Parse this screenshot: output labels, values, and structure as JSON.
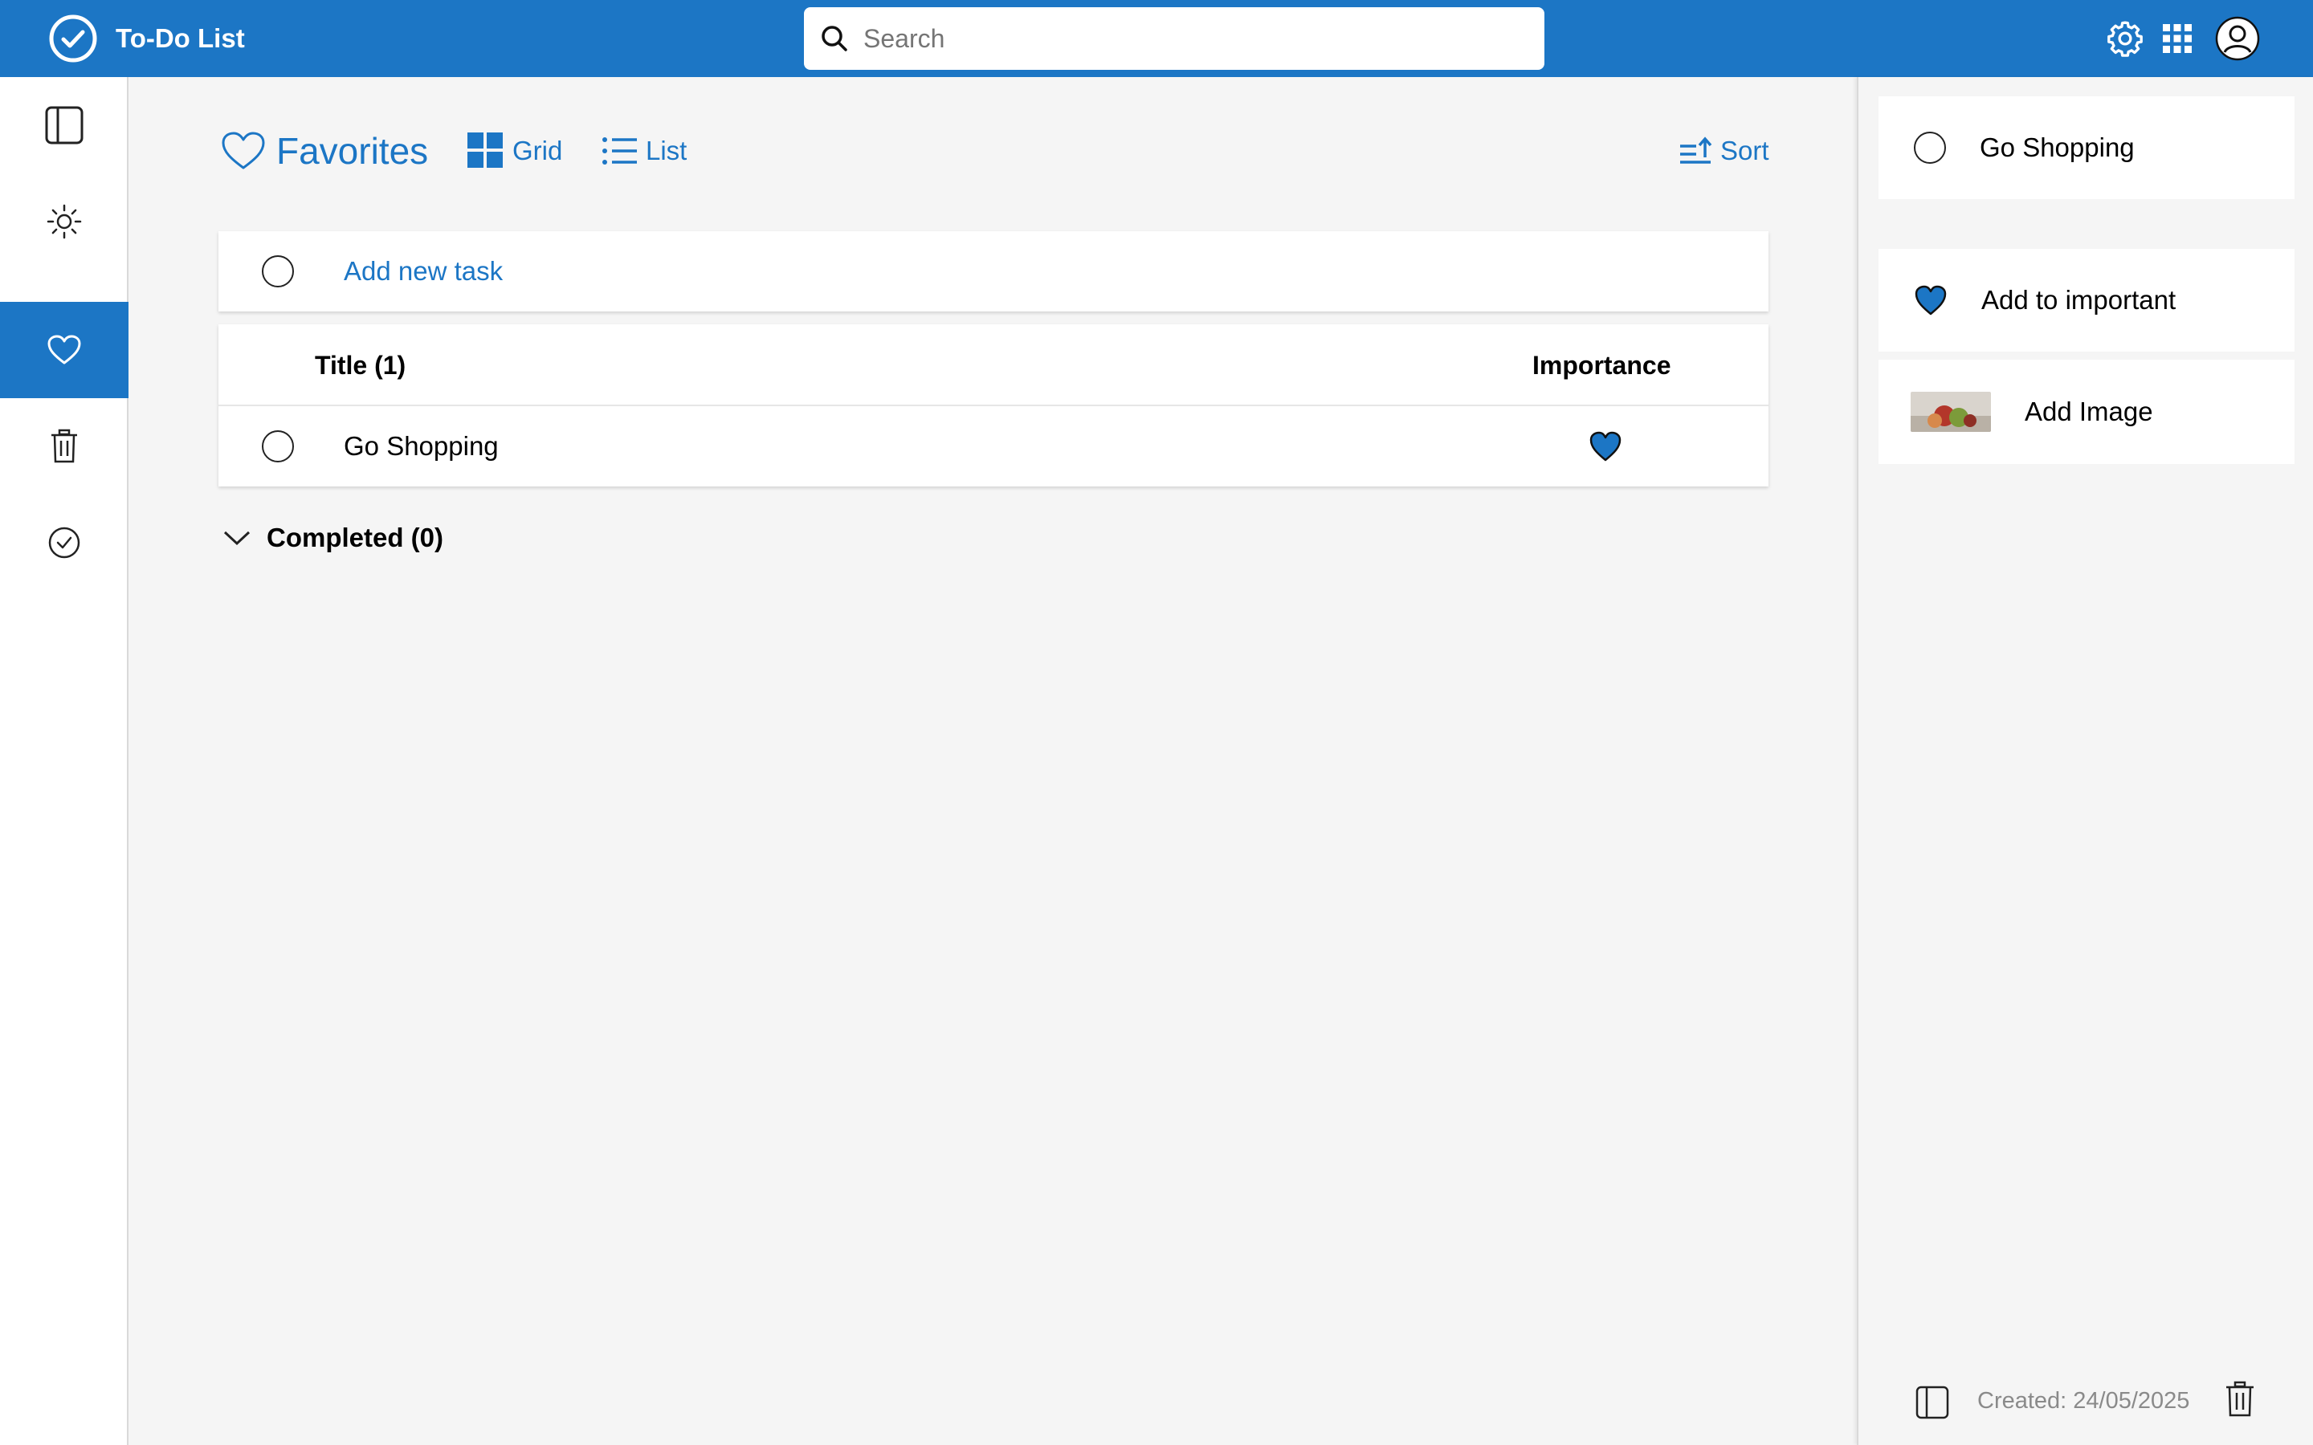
{
  "app": {
    "title": "To-Do List"
  },
  "search": {
    "placeholder": "Search"
  },
  "header_icons": [
    "settings-gear-icon",
    "apps-grid-icon",
    "user-avatar-icon"
  ],
  "nav": {
    "items": [
      {
        "name": "toggle-sidebar",
        "icon": "panel-icon"
      },
      {
        "name": "my-day",
        "icon": "sun-icon"
      },
      {
        "name": "favorites",
        "icon": "heart-icon",
        "active": true
      },
      {
        "name": "trash",
        "icon": "trash-icon"
      },
      {
        "name": "completed",
        "icon": "check-circle-icon"
      }
    ]
  },
  "main": {
    "title": "Favorites",
    "view_grid_label": "Grid",
    "view_list_label": "List",
    "sort_label": "Sort",
    "add_task_label": "Add new task",
    "table": {
      "title_header": "Title (1)",
      "importance_header": "Importance",
      "rows": [
        {
          "title": "Go Shopping",
          "important": true
        }
      ]
    },
    "completed_label": "Completed (0)"
  },
  "detail": {
    "task_title": "Go Shopping",
    "add_important_label": "Add to important",
    "add_image_label": "Add Image",
    "created": "Created: 24/05/2025"
  },
  "colors": {
    "accent": "#1c76c5",
    "background": "#f5f5f5",
    "muted_text": "#8a8a8a"
  }
}
